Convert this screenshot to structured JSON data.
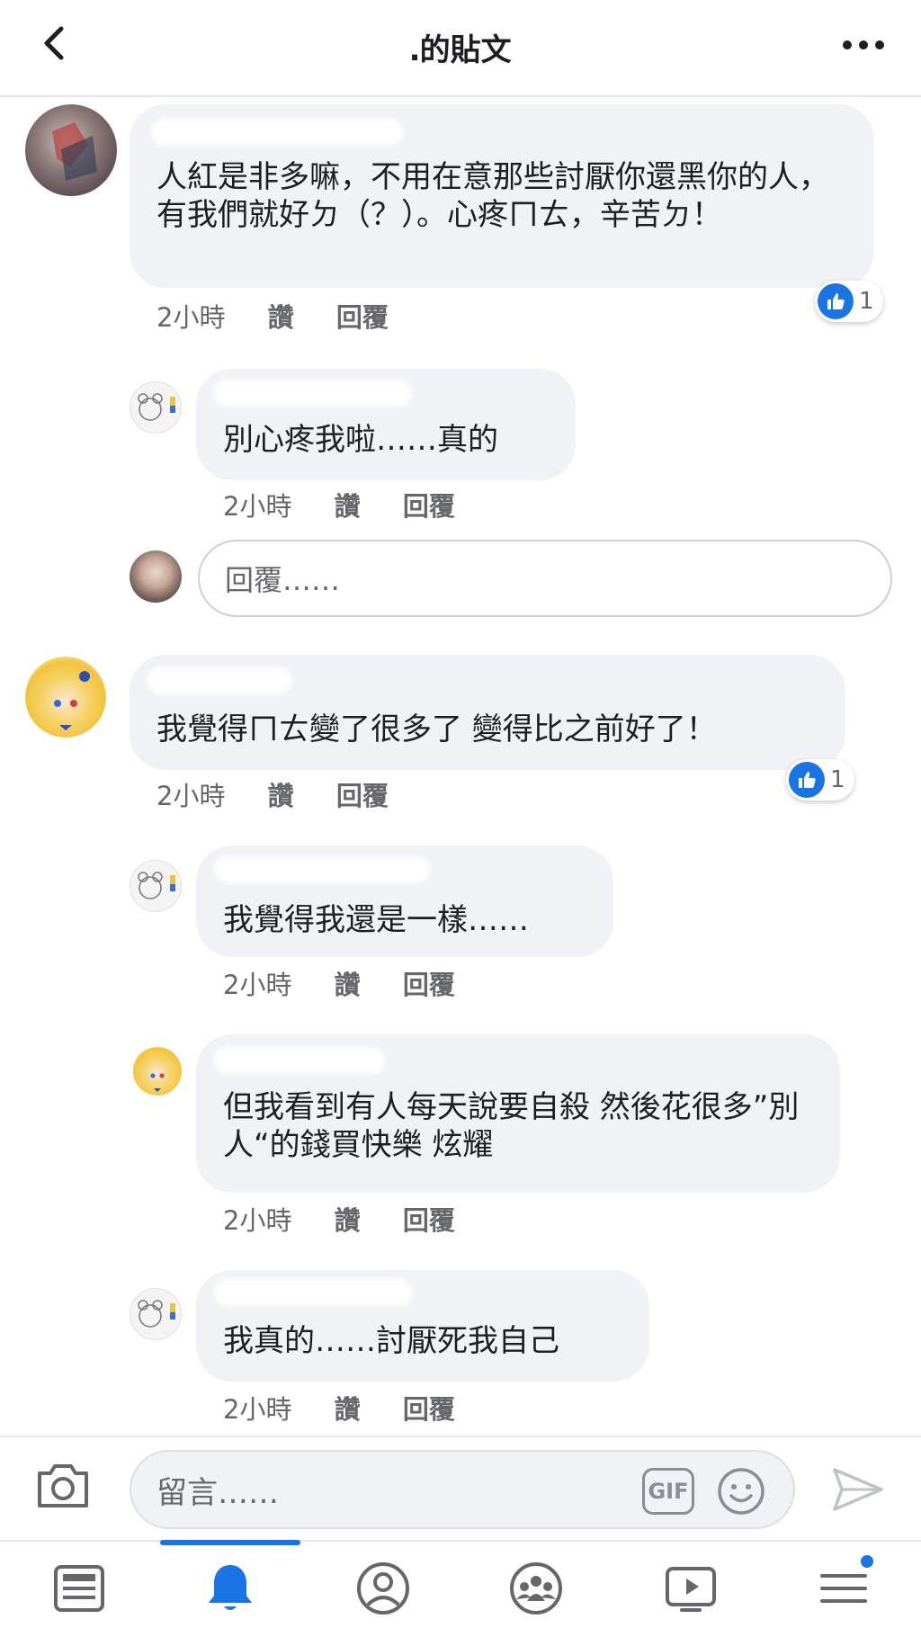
{
  "header": {
    "title": "․的貼文"
  },
  "comments": [
    {
      "text": "人紅是非多嘛，不用在意那些討厭你還黑你的人，有我們就好ㄉ（？）。心疼ㄇㄊ，辛苦ㄉ！",
      "time": "2小時",
      "like": "讚",
      "reply": "回覆",
      "reaction_count": "1"
    },
    {
      "text": "別心疼我啦……真的",
      "time": "2小時",
      "like": "讚",
      "reply": "回覆"
    },
    {
      "text": "我覺得ㄇㄊ變了很多了 變得比之前好了！",
      "time": "2小時",
      "like": "讚",
      "reply": "回覆",
      "reaction_count": "1"
    },
    {
      "text": "我覺得我還是一樣……",
      "time": "2小時",
      "like": "讚",
      "reply": "回覆"
    },
    {
      "text": "但我看到有人每天說要自殺 然後花很多”別人“的錢買快樂 炫耀",
      "time": "2小時",
      "like": "讚",
      "reply": "回覆"
    },
    {
      "text": "我真的……討厭死我自己",
      "time": "2小時",
      "like": "讚",
      "reply": "回覆"
    }
  ],
  "reply_box": {
    "placeholder": "回覆……"
  },
  "composer": {
    "placeholder": "留言……",
    "gif_label": "GIF"
  },
  "bottom_nav": {
    "items": [
      "news-feed",
      "notifications",
      "profile",
      "groups",
      "watch",
      "menu"
    ],
    "active": "notifications"
  },
  "colors": {
    "accent": "#1b74e4",
    "bubble": "#f0f2f5",
    "meta_text": "#65676b"
  }
}
